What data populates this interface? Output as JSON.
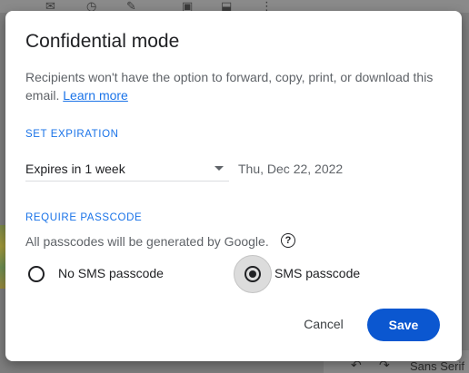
{
  "dialog": {
    "title": "Confidential mode",
    "description": "Recipients won't have the option to forward, copy, print, or download this email.",
    "learn_more": "Learn more",
    "expiration": {
      "heading": "SET EXPIRATION",
      "selected": "Expires in 1 week",
      "date": "Thu, Dec 22, 2022"
    },
    "passcode": {
      "heading": "REQUIRE PASSCODE",
      "note": "All passcodes will be generated by Google.",
      "help_icon": "?",
      "options": [
        {
          "label": "No SMS passcode",
          "selected": false
        },
        {
          "label": "SMS passcode",
          "selected": true
        }
      ]
    },
    "buttons": {
      "cancel": "Cancel",
      "save": "Save"
    }
  },
  "background": {
    "bottom_font_label": "Sans Serif",
    "icons": [
      "mail-icon",
      "clock-icon",
      "edit-check-icon",
      "save-icon",
      "label-icon",
      "more-vert-icon",
      "undo-icon",
      "redo-icon"
    ]
  },
  "colors": {
    "accent": "#1a73e8",
    "primary_button": "#0b57d0",
    "text": "#202124",
    "muted": "#5f6368"
  }
}
